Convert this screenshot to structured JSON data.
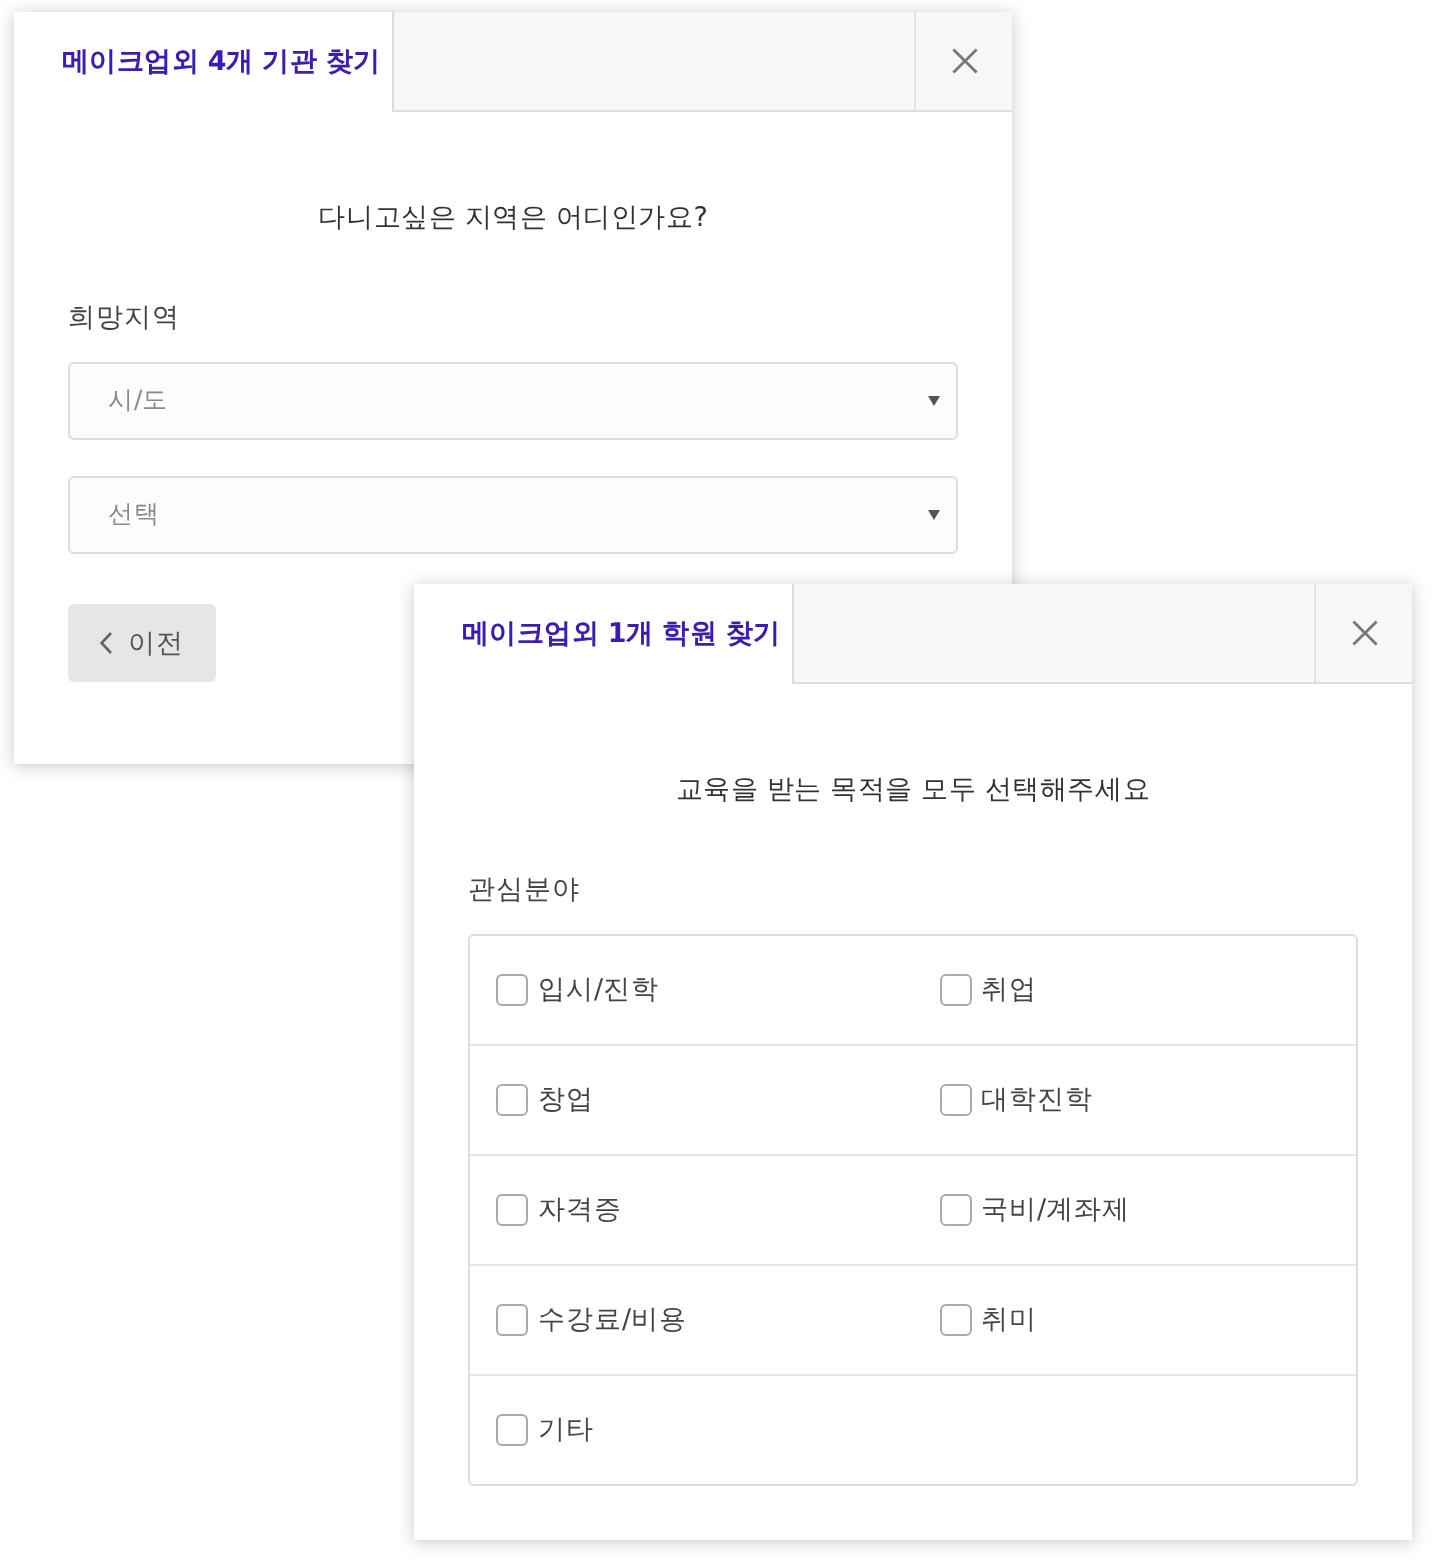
{
  "dialogs": [
    {
      "tab": {
        "label": "메이크업외 4개 기관 찾기",
        "selected": true
      },
      "question": "다니고싶은 지역은 어디인가요?",
      "field_label": "희망지역",
      "selects": [
        {
          "placeholder": "시/도"
        },
        {
          "placeholder": "선택"
        }
      ],
      "back_button": {
        "label": "이전"
      }
    },
    {
      "tab": {
        "label": "메이크업외 1개 학원 찾기",
        "selected": true
      },
      "question": "교육을 받는 목적을 모두 선택해주세요",
      "field_label": "관심분야",
      "options": [
        {
          "label": "입시/진학",
          "checked": false
        },
        {
          "label": "취업",
          "checked": false
        },
        {
          "label": "창업",
          "checked": false
        },
        {
          "label": "대학진학",
          "checked": false
        },
        {
          "label": "자격증",
          "checked": false
        },
        {
          "label": "국비/계좌제",
          "checked": false
        },
        {
          "label": "수강료/비용",
          "checked": false
        },
        {
          "label": "취미",
          "checked": false
        },
        {
          "label": "기타",
          "checked": false
        }
      ]
    }
  ]
}
